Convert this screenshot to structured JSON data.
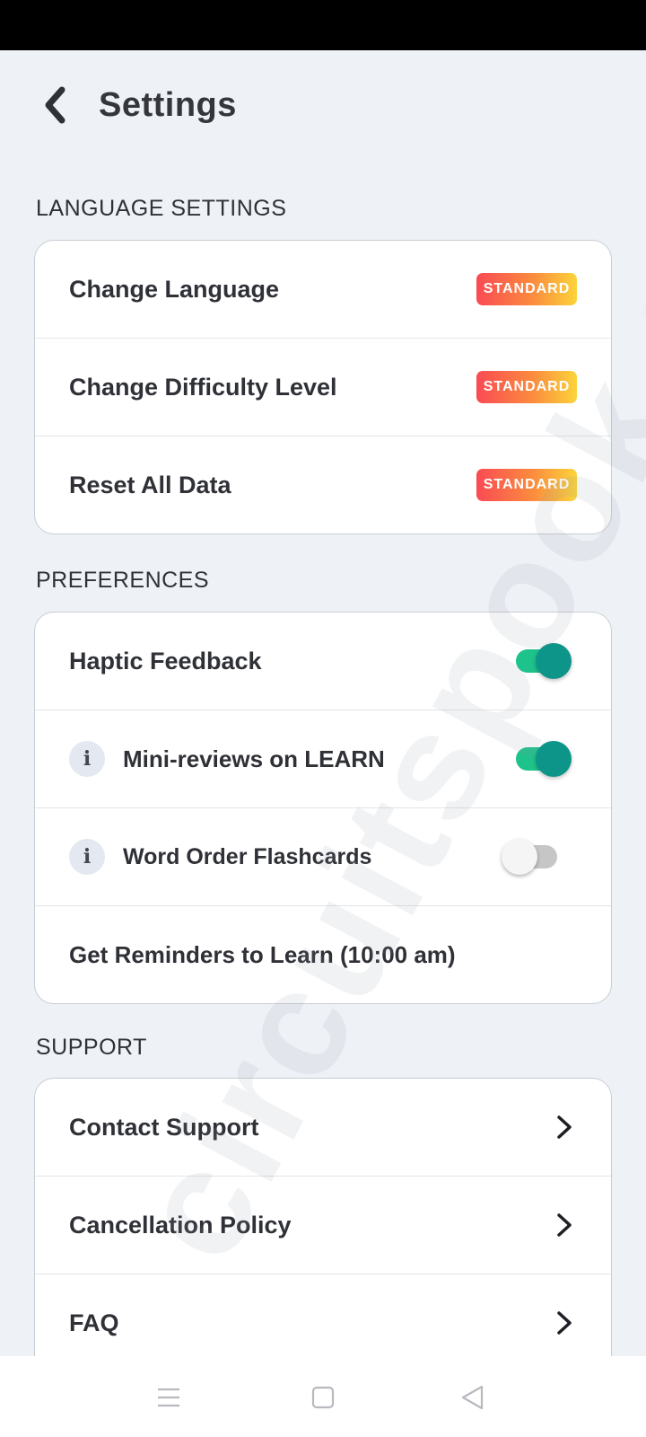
{
  "header": {
    "title": "Settings"
  },
  "sections": {
    "language": {
      "label": "LANGUAGE SETTINGS",
      "rows": [
        {
          "label": "Change Language",
          "badge": "STANDARD"
        },
        {
          "label": "Change Difficulty Level",
          "badge": "STANDARD"
        },
        {
          "label": "Reset All Data",
          "badge": "STANDARD"
        }
      ]
    },
    "preferences": {
      "label": "PREFERENCES",
      "rows": [
        {
          "label": "Haptic Feedback",
          "toggle": "on"
        },
        {
          "label": "Mini-reviews on LEARN",
          "info_icon": "i",
          "toggle": "on"
        },
        {
          "label": "Word Order Flashcards",
          "info_icon": "i",
          "toggle": "off"
        },
        {
          "label": "Get Reminders to Learn (10:00 am)"
        }
      ]
    },
    "support": {
      "label": "SUPPORT",
      "rows": [
        {
          "label": "Contact Support"
        },
        {
          "label": "Cancellation Policy"
        },
        {
          "label": "FAQ"
        }
      ]
    }
  },
  "watermark": "circuitspook.com",
  "colors": {
    "background": "#eef2f7",
    "toggle_on_track": "#1ec28b",
    "toggle_on_knob": "#0d958a",
    "badge_gradient_start": "#fa4a54",
    "badge_gradient_end": "#fbd43a"
  },
  "icons": {
    "back": "chevron-left-icon",
    "row_arrow": "chevron-right-icon",
    "info": "info-icon",
    "nav": [
      "menu-icon",
      "home-square-icon",
      "back-triangle-icon"
    ]
  }
}
